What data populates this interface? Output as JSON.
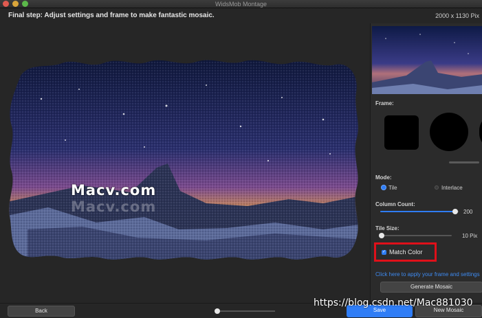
{
  "window": {
    "title": "WidsMob Montage"
  },
  "step": {
    "text": "Final step: Adjust settings and frame to make fantastic mosaic.",
    "dimensions": "2000 x 1130 Pix"
  },
  "canvas": {
    "watermark": "Macv.com"
  },
  "sidebar": {
    "frame_label": "Frame:",
    "mode_label": "Mode:",
    "mode_options": [
      "Tile",
      "Interlace"
    ],
    "mode_selected": "Tile",
    "column_count_label": "Column Count:",
    "column_count_value": "200",
    "column_count_level": 0.96,
    "tile_size_label": "Tile Size:",
    "tile_size_value": "10 Pix",
    "tile_size_level": 0.0,
    "match_color_label": "Match Color",
    "match_color_checked": true,
    "apply_link": "Click here to apply your frame and settings",
    "generate_button": "Generate Mosaic"
  },
  "footer": {
    "back_button": "Back",
    "save_button": "Save",
    "new_mosaic_button": "New Mosaic",
    "zoom_level": 0.0
  },
  "overlay": {
    "csdn_watermark": "https://blog.csdn.net/Mac881030"
  },
  "colors": {
    "accent": "#2f7df6",
    "highlight_border": "#e0101a",
    "link": "#3e8bf2"
  }
}
